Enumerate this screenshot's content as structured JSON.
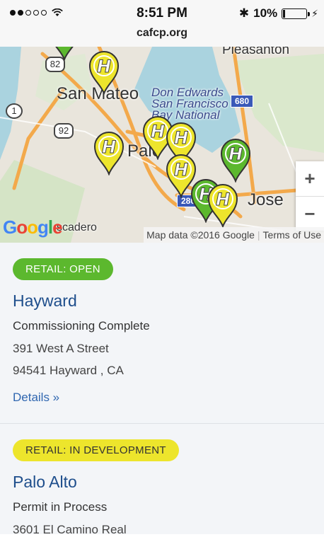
{
  "status_bar": {
    "time": "8:51 PM",
    "battery_percent": "10%",
    "battery_level": 0.1,
    "signal_bars_filled": 2,
    "signal_bars_total": 5
  },
  "browser": {
    "url": "cafcp.org"
  },
  "map": {
    "places": {
      "pleasanton": "Pleasanton",
      "san_mateo": "San Mateo",
      "don_edwards_1": "Don Edwards",
      "don_edwards_2": "San Francisco",
      "don_edwards_3": "Bay National",
      "palo": "Palo",
      "jose": "Jose",
      "escadero": "scadero"
    },
    "highway_shields": {
      "h82": "82",
      "h1": "1",
      "h92": "92",
      "h680": "680",
      "h280": "280"
    },
    "zoom_in": "+",
    "zoom_out": "−",
    "attribution": "Map data ©2016 Google",
    "terms": "Terms of Use",
    "pin_letter": "H",
    "pin_colors": {
      "open": "#5cb82e",
      "development": "#ede52c"
    }
  },
  "stations": [
    {
      "badge": "RETAIL: OPEN",
      "name": "Hayward",
      "status": "Commissioning Complete",
      "address_line1": "391 West A Street",
      "address_line2": "94541 Hayward , CA",
      "details": "Details »"
    },
    {
      "badge": "RETAIL: IN DEVELOPMENT",
      "name": "Palo Alto",
      "status": "Permit in Process",
      "address_line1": "3601 El Camino Real"
    }
  ]
}
